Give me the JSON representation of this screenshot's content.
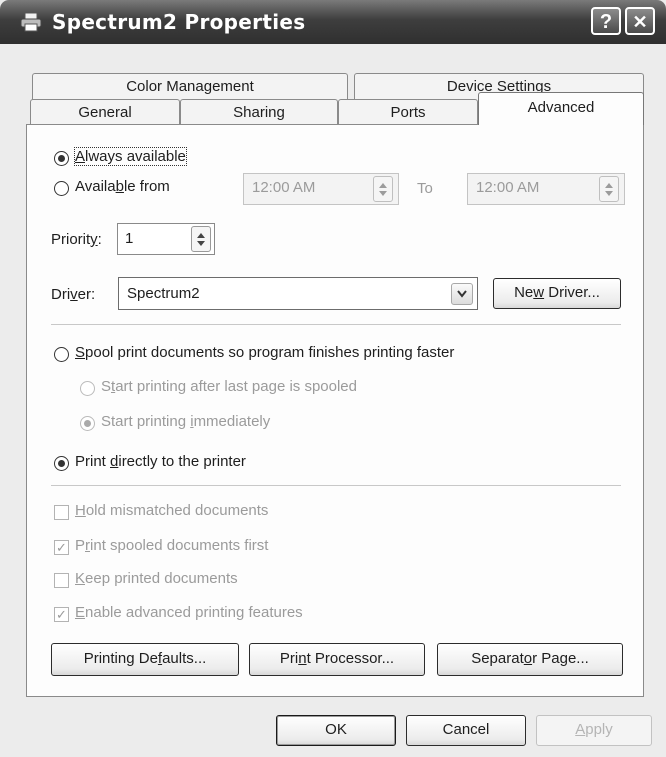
{
  "window": {
    "title": "Spectrum2 Properties",
    "help_glyph": "?",
    "close_glyph": "✕",
    "icon": "printer-icon"
  },
  "tabs": {
    "row1": [
      "Color Management",
      "Device Settings"
    ],
    "row2": [
      "General",
      "Sharing",
      "Ports",
      "Advanced"
    ]
  },
  "availability": {
    "always_pre": "",
    "always_key": "A",
    "always_post": "lways available",
    "from_pre": "Availa",
    "from_key": "b",
    "from_post": "le from",
    "from_time": "12:00 AM",
    "to_label": "To",
    "to_time": "12:00 AM",
    "selected": "always"
  },
  "priority": {
    "pre": "Priorit",
    "key": "y",
    "post": ":",
    "value": "1"
  },
  "driver": {
    "pre": "Dri",
    "key": "v",
    "post": "er:",
    "value": "Spectrum2",
    "new_pre": "Ne",
    "new_key": "w",
    "new_post": " Driver..."
  },
  "spool": {
    "main_pre": "",
    "main_key": "S",
    "main_post": "pool print documents so program finishes printing faster",
    "after_pre": "S",
    "after_key": "t",
    "after_post": "art printing after last page is spooled",
    "imm_pre": "Start printing ",
    "imm_key": "i",
    "imm_post": "mmediately",
    "direct_pre": "Print ",
    "direct_key": "d",
    "direct_post": "irectly to the printer",
    "selected": "direct"
  },
  "options": [
    {
      "pre": "",
      "key": "H",
      "post": "old mismatched documents",
      "checked": false
    },
    {
      "pre": "P",
      "key": "r",
      "post": "int spooled documents first",
      "checked": true
    },
    {
      "pre": "",
      "key": "K",
      "post": "eep printed documents",
      "checked": false
    },
    {
      "pre": "",
      "key": "E",
      "post": "nable advanced printing features",
      "checked": true
    }
  ],
  "bottom_buttons": {
    "defaults_pre": "Printing De",
    "defaults_key": "f",
    "defaults_post": "aults...",
    "processor_pre": "Pri",
    "processor_key": "n",
    "processor_post": "t Processor...",
    "separator_pre": "Separat",
    "separator_key": "o",
    "separator_post": "r Page..."
  },
  "dialog_buttons": {
    "ok": "OK",
    "cancel": "Cancel",
    "apply_pre": "",
    "apply_key": "A",
    "apply_post": "pply"
  },
  "colors": {
    "title_bar": "#3e3e3e",
    "panel_bg": "#fdfdfd",
    "disabled_text": "#9b9b9b"
  }
}
